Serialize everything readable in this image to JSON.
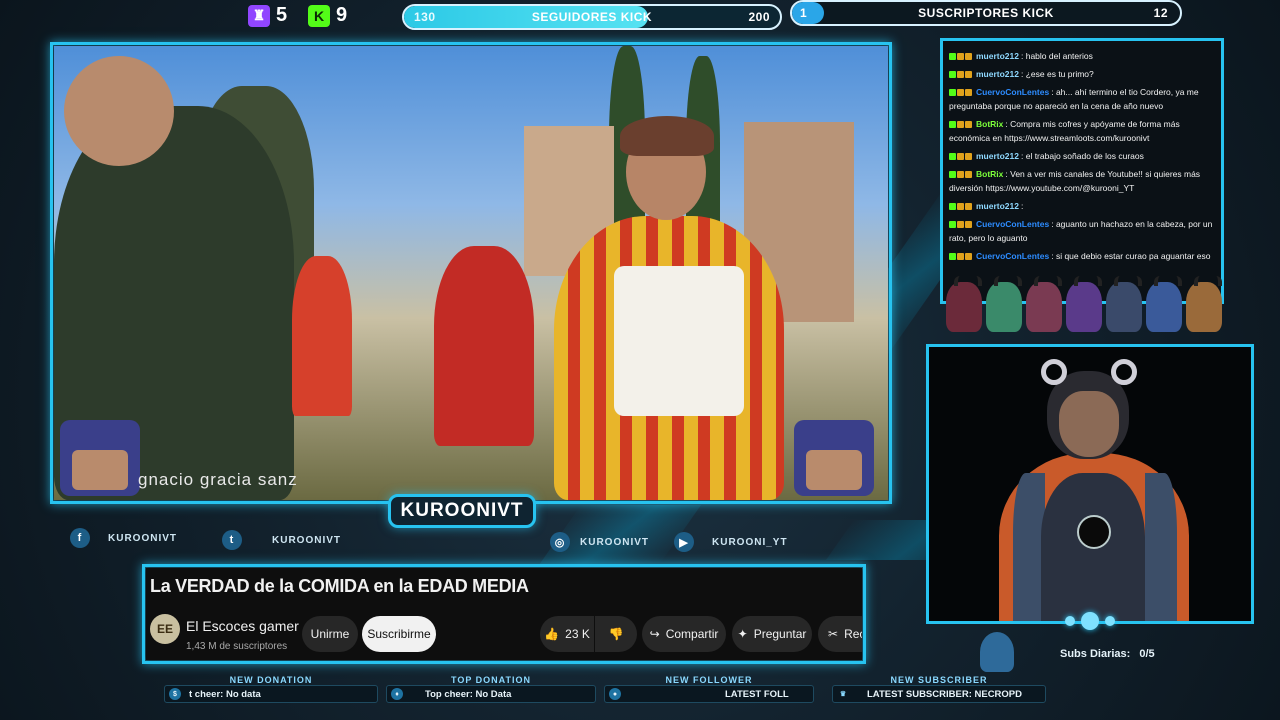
{
  "colors": {
    "accent": "#27c3f0",
    "twitch": "#9146ff",
    "kick": "#53fc18",
    "seguidores_fill": "#3ad1e8"
  },
  "counters": {
    "twitch": {
      "icon": "twitch-icon",
      "value": "5"
    },
    "kick": {
      "icon": "kick-icon",
      "value": "9"
    }
  },
  "followers_goal": {
    "label": "SEGUIDORES KICK",
    "current": "130",
    "target": "200",
    "progress": 0.65
  },
  "subscribers_goal": {
    "label": "SUSCRIPTORES KICK",
    "current": "1",
    "target": "12",
    "progress": 0.083
  },
  "video": {
    "watermark": "gnacio gracia sanz"
  },
  "channel_tag": "KUROONIVT",
  "socials": [
    {
      "icon": "facebook-icon",
      "glyph": "f",
      "label": "KUROONIVT"
    },
    {
      "icon": "twitter-icon",
      "glyph": "t",
      "label": "KUROONIVT"
    },
    {
      "icon": "instagram-icon",
      "glyph": "◎",
      "label": "KUROONIVT"
    },
    {
      "icon": "youtube-icon",
      "glyph": "▶",
      "label": "KUROONI_YT"
    }
  ],
  "youtube": {
    "title": "La VERDAD de la COMIDA en la EDAD MEDIA",
    "channel_logo": "EE",
    "channel": "El Escoces gamer",
    "subscribers": "1,43 M de suscriptores",
    "unsubscribe": "Unirme",
    "subscribe": "Suscribirme",
    "likes": "23 K",
    "share": "Compartir",
    "ask": "Preguntar",
    "clip": "Rec"
  },
  "chat": {
    "messages": [
      {
        "user": "muerto212",
        "color": "#8fd9ff",
        "text": ": hablo del anterios"
      },
      {
        "user": "muerto212",
        "color": "#8fd9ff",
        "text": ": ¿ese es tu primo?"
      },
      {
        "user": "CuervoConLentes",
        "color": "#2d8cff",
        "text": ": ah... ahí termino el tio Cordero, ya me preguntaba porque no apareció en la cena de año nuevo"
      },
      {
        "user": "BotRix",
        "color": "#7cff3a",
        "text": ": Compra mis cofres y apóyame de forma más económica en https://www.streamloots.com/kurooni​vt"
      },
      {
        "user": "muerto212",
        "color": "#8fd9ff",
        "text": ": el trabajo soñado de los curaos"
      },
      {
        "user": "BotRix",
        "color": "#7cff3a",
        "text": ": Ven a ver mis canales de Youtube!! si quieres más diversión https://www.youtube.com/@kurooni_YT"
      },
      {
        "user": "muerto212",
        "color": "#8fd9ff",
        "text": ":"
      },
      {
        "user": "CuervoConLentes",
        "color": "#2d8cff",
        "text": ": aguanto un hachazo en la cabeza, por un rato, pero lo aguanto"
      },
      {
        "user": "CuervoConLentes",
        "color": "#2d8cff",
        "text": ": si que debio estar curao pa aguantar eso"
      }
    ]
  },
  "subs_daily": {
    "label": "Subs Diarias:",
    "value": "0/5"
  },
  "tickers": [
    {
      "title": "NEW DONATION",
      "icon": "donation-icon",
      "text": "t cheer: No data"
    },
    {
      "title": "TOP DONATION",
      "icon": "bag-icon",
      "text": "Top cheer: No Data"
    },
    {
      "title": "NEW FOLLOWER",
      "icon": "user-icon",
      "text": "LATEST FOLL"
    },
    {
      "title": "NEW SUBSCRIBER",
      "icon": "crown-icon",
      "text": "LATEST SUBSCRIBER: NECROPD"
    }
  ]
}
